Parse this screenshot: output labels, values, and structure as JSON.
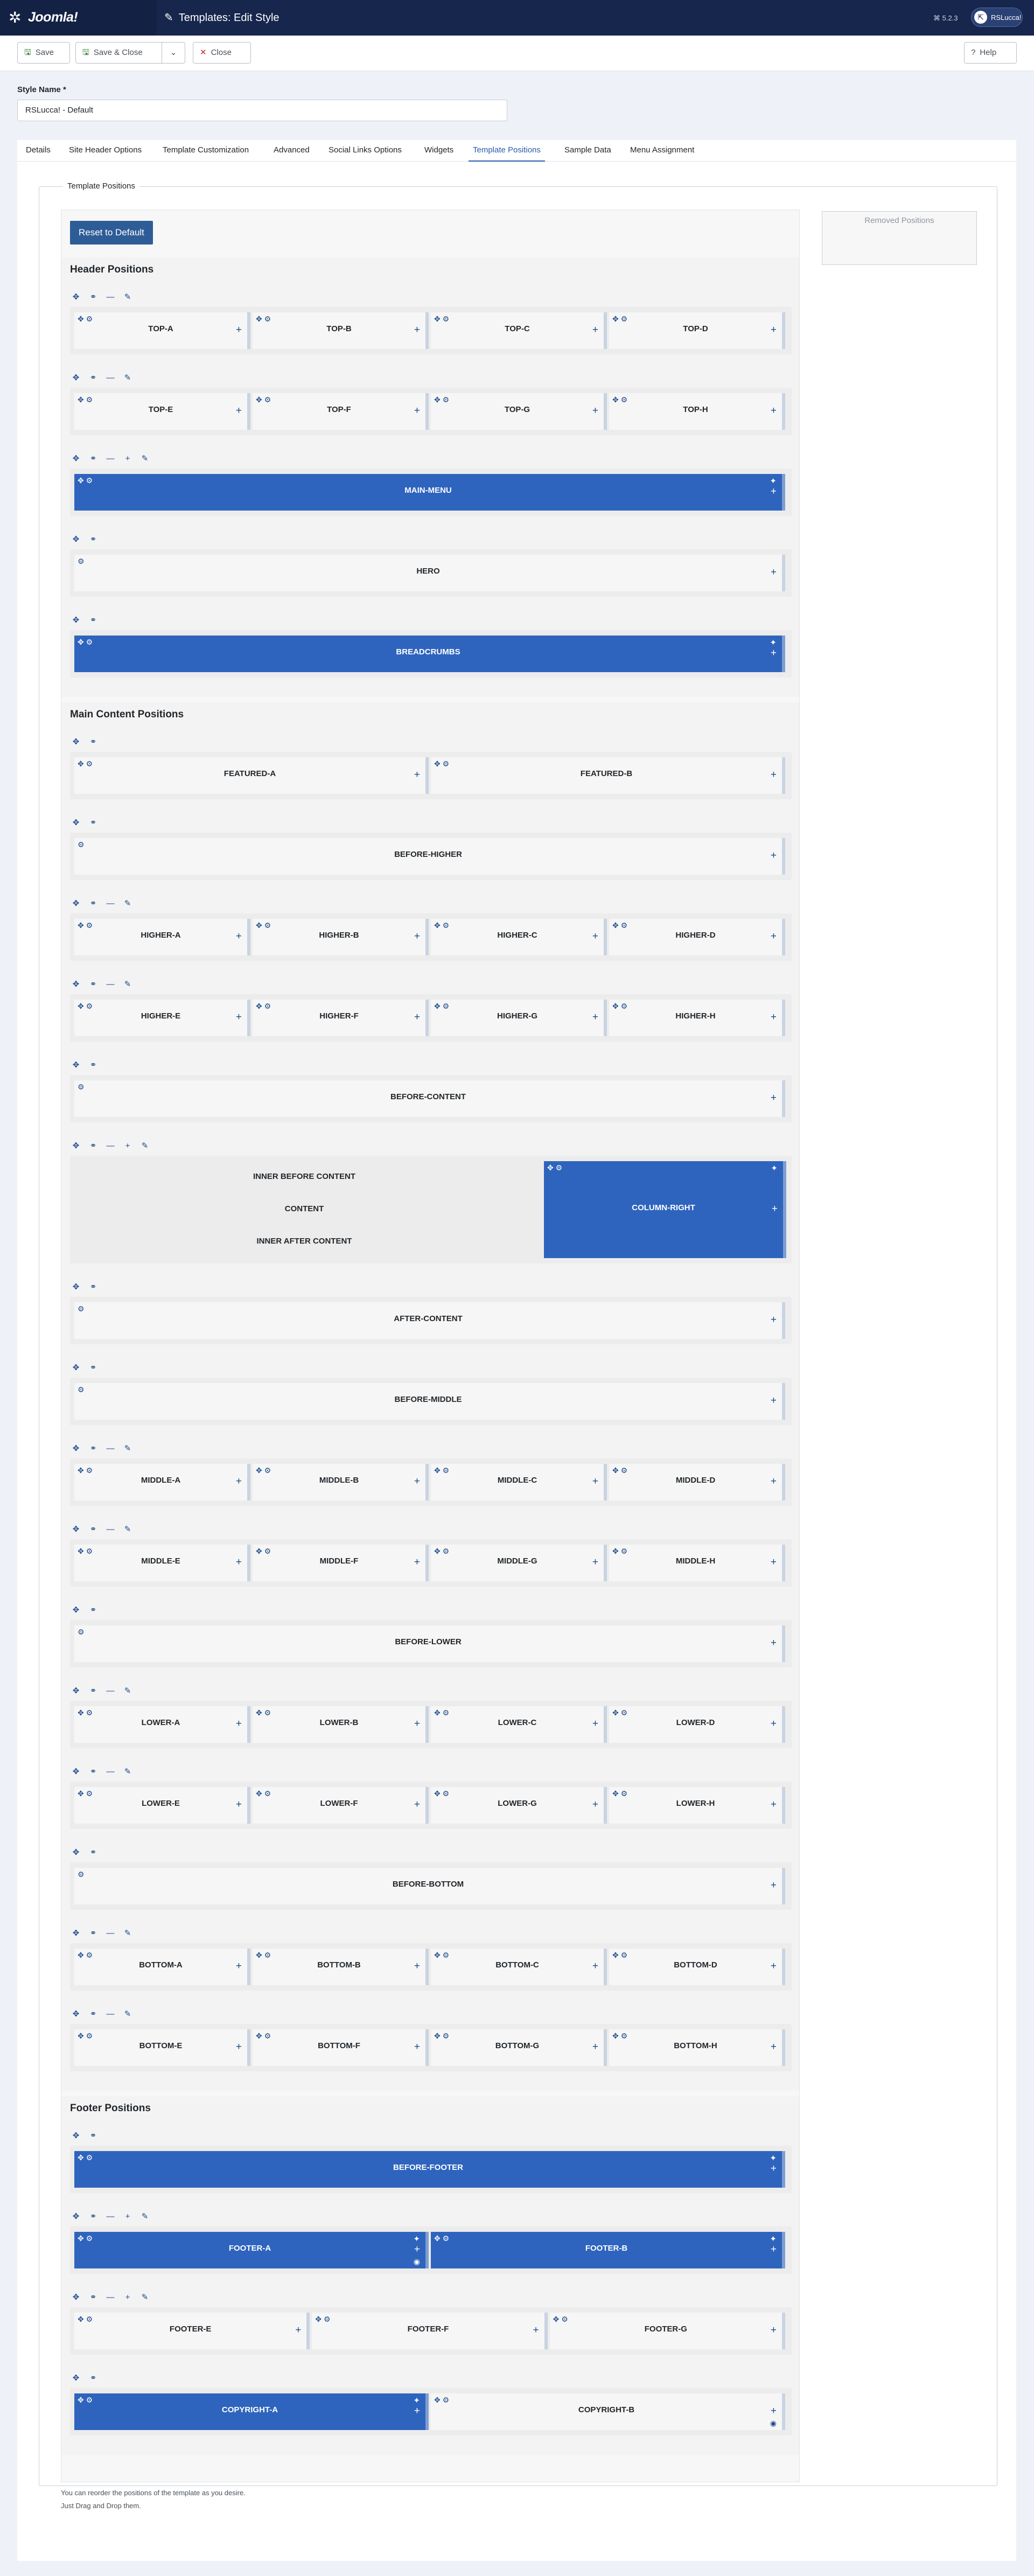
{
  "header": {
    "logo": "Joomla!",
    "title": "Templates: Edit Style",
    "version": "⌘ 5.2.3",
    "user": "RSLucca!"
  },
  "toolbar": {
    "save": "Save",
    "save_close": "Save & Close",
    "close": "Close",
    "help": "Help"
  },
  "form": {
    "style_name_label": "Style Name *",
    "style_name_value": "RSLucca! - Default"
  },
  "tabs": [
    "Details",
    "Site Header Options",
    "Template Customization",
    "Advanced",
    "Social Links Options",
    "Widgets",
    "Template Positions",
    "Sample Data",
    "Menu Assignment"
  ],
  "panel": {
    "legend": "Template Positions",
    "reset": "Reset to Default",
    "removed": "Removed Positions",
    "hint1": "You can reorder the positions of the template as you desire.",
    "hint2": "Just Drag and Drop them."
  },
  "sections": [
    {
      "title": "Header Positions",
      "rows": [
        {
          "controls": [
            "move",
            "link",
            "minus",
            "edit"
          ],
          "cells": [
            {
              "name": "TOP-A"
            },
            {
              "name": "TOP-B"
            },
            {
              "name": "TOP-C"
            },
            {
              "name": "TOP-D"
            }
          ]
        },
        {
          "controls": [
            "move",
            "link",
            "minus",
            "edit"
          ],
          "cells": [
            {
              "name": "TOP-E"
            },
            {
              "name": "TOP-F"
            },
            {
              "name": "TOP-G"
            },
            {
              "name": "TOP-H"
            }
          ]
        },
        {
          "controls": [
            "move",
            "link",
            "minus",
            "plus",
            "edit"
          ],
          "cells": [
            {
              "name": "MAIN-MENU",
              "blue": true
            }
          ]
        },
        {
          "controls": [
            "move",
            "link"
          ],
          "cells": [
            {
              "name": "HERO"
            }
          ]
        },
        {
          "controls": [
            "move",
            "link"
          ],
          "cells": [
            {
              "name": "BREADCRUMBS",
              "blue": true
            }
          ]
        }
      ]
    },
    {
      "title": "Main Content Positions",
      "rows": [
        {
          "controls": [
            "move",
            "link"
          ],
          "cells": [
            {
              "name": "FEATURED-A"
            },
            {
              "name": "FEATURED-B"
            }
          ]
        },
        {
          "controls": [
            "move",
            "link"
          ],
          "cells": [
            {
              "name": "BEFORE-HIGHER"
            }
          ]
        },
        {
          "controls": [
            "move",
            "link",
            "minus",
            "edit"
          ],
          "cells": [
            {
              "name": "HIGHER-A"
            },
            {
              "name": "HIGHER-B"
            },
            {
              "name": "HIGHER-C"
            },
            {
              "name": "HIGHER-D"
            }
          ]
        },
        {
          "controls": [
            "move",
            "link",
            "minus",
            "edit"
          ],
          "cells": [
            {
              "name": "HIGHER-E"
            },
            {
              "name": "HIGHER-F"
            },
            {
              "name": "HIGHER-G"
            },
            {
              "name": "HIGHER-H"
            }
          ]
        },
        {
          "controls": [
            "move",
            "link"
          ],
          "cells": [
            {
              "name": "BEFORE-CONTENT"
            }
          ]
        },
        {
          "controls": [
            "move",
            "link",
            "minus",
            "plus",
            "edit"
          ],
          "content": [
            "INNER BEFORE CONTENT",
            "CONTENT",
            "INNER AFTER CONTENT"
          ],
          "cells": [
            {
              "name": "COLUMN-RIGHT",
              "blue": true
            }
          ]
        },
        {
          "controls": [
            "move",
            "link"
          ],
          "cells": [
            {
              "name": "AFTER-CONTENT"
            }
          ]
        },
        {
          "controls": [
            "move",
            "link"
          ],
          "cells": [
            {
              "name": "BEFORE-MIDDLE"
            }
          ]
        },
        {
          "controls": [
            "move",
            "link",
            "minus",
            "edit"
          ],
          "cells": [
            {
              "name": "MIDDLE-A"
            },
            {
              "name": "MIDDLE-B"
            },
            {
              "name": "MIDDLE-C"
            },
            {
              "name": "MIDDLE-D"
            }
          ]
        },
        {
          "controls": [
            "move",
            "link",
            "minus",
            "edit"
          ],
          "cells": [
            {
              "name": "MIDDLE-E"
            },
            {
              "name": "MIDDLE-F"
            },
            {
              "name": "MIDDLE-G"
            },
            {
              "name": "MIDDLE-H"
            }
          ]
        },
        {
          "controls": [
            "move",
            "link"
          ],
          "cells": [
            {
              "name": "BEFORE-LOWER"
            }
          ]
        },
        {
          "controls": [
            "move",
            "link",
            "minus",
            "edit"
          ],
          "cells": [
            {
              "name": "LOWER-A"
            },
            {
              "name": "LOWER-B"
            },
            {
              "name": "LOWER-C"
            },
            {
              "name": "LOWER-D"
            }
          ]
        },
        {
          "controls": [
            "move",
            "link",
            "minus",
            "edit"
          ],
          "cells": [
            {
              "name": "LOWER-E"
            },
            {
              "name": "LOWER-F"
            },
            {
              "name": "LOWER-G"
            },
            {
              "name": "LOWER-H"
            }
          ]
        },
        {
          "controls": [
            "move",
            "link"
          ],
          "cells": [
            {
              "name": "BEFORE-BOTTOM"
            }
          ]
        },
        {
          "controls": [
            "move",
            "link",
            "minus",
            "edit"
          ],
          "cells": [
            {
              "name": "BOTTOM-A"
            },
            {
              "name": "BOTTOM-B"
            },
            {
              "name": "BOTTOM-C"
            },
            {
              "name": "BOTTOM-D"
            }
          ]
        },
        {
          "controls": [
            "move",
            "link",
            "minus",
            "edit"
          ],
          "cells": [
            {
              "name": "BOTTOM-E"
            },
            {
              "name": "BOTTOM-F"
            },
            {
              "name": "BOTTOM-G"
            },
            {
              "name": "BOTTOM-H"
            }
          ]
        }
      ]
    },
    {
      "title": "Footer Positions",
      "rows": [
        {
          "controls": [
            "move",
            "link"
          ],
          "cells": [
            {
              "name": "BEFORE-FOOTER",
              "blue": true
            }
          ]
        },
        {
          "controls": [
            "move",
            "link",
            "minus",
            "plus",
            "edit"
          ],
          "cells": [
            {
              "name": "FOOTER-A",
              "blue": true,
              "eye": true
            },
            {
              "name": "FOOTER-B",
              "blue": true
            }
          ]
        },
        {
          "controls": [
            "move",
            "link",
            "minus",
            "plus",
            "edit"
          ],
          "cells": [
            {
              "name": "FOOTER-E"
            },
            {
              "name": "FOOTER-F"
            },
            {
              "name": "FOOTER-G"
            }
          ]
        },
        {
          "controls": [
            "move",
            "link"
          ],
          "cells": [
            {
              "name": "COPYRIGHT-A",
              "blue": true
            },
            {
              "name": "COPYRIGHT-B",
              "eye": true
            }
          ]
        }
      ]
    }
  ],
  "colors": {
    "header": "#16264c",
    "accent": "#2a5ba8",
    "position_blue": "#2e64bd"
  }
}
